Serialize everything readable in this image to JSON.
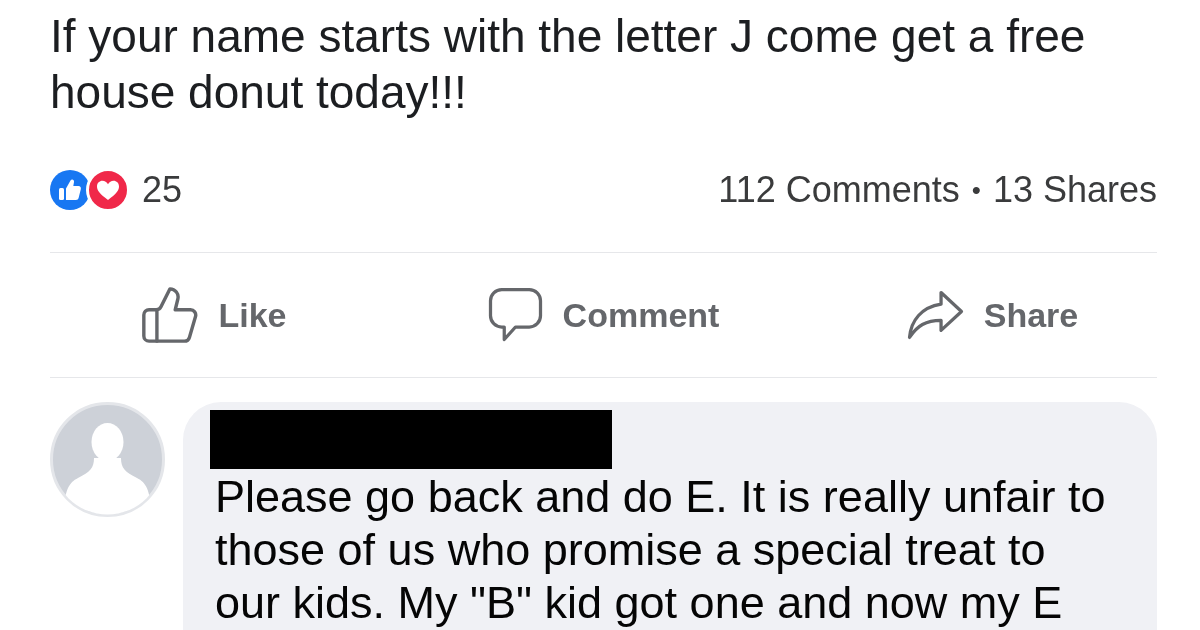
{
  "post": {
    "text": "If your name starts with the letter J come get a free house donut today!!!"
  },
  "reactions": {
    "types": [
      {
        "kind": "like"
      },
      {
        "kind": "love"
      }
    ],
    "count": "25"
  },
  "stats": {
    "comments": "112 Comments",
    "separator": "•",
    "shares": "13 Shares"
  },
  "actions": [
    {
      "kind": "like",
      "label": "Like"
    },
    {
      "kind": "comment",
      "label": "Comment"
    },
    {
      "kind": "share",
      "label": "Share"
    }
  ],
  "comment": {
    "author_redacted": true,
    "text": "Please go back and do E. It is really unfair to those of us who promise a special treat to our kids. My \"B\" kid got one and now my E"
  }
}
